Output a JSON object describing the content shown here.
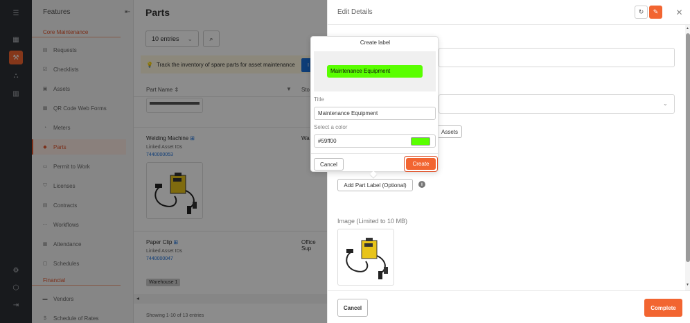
{
  "sidebar": {
    "header": "Features",
    "sections": {
      "core": "Core Maintenance",
      "financial": "Financial"
    },
    "items": [
      {
        "label": "Requests",
        "icon": "requests-icon"
      },
      {
        "label": "Checklists",
        "icon": "checklist-icon"
      },
      {
        "label": "Assets",
        "icon": "assets-icon"
      },
      {
        "label": "QR Code Web Forms",
        "icon": "qr-icon"
      },
      {
        "label": "Meters",
        "icon": "meter-icon"
      },
      {
        "label": "Parts",
        "icon": "parts-icon",
        "active": true
      },
      {
        "label": "Permit to Work",
        "icon": "permit-icon"
      },
      {
        "label": "Licenses",
        "icon": "shield-icon"
      },
      {
        "label": "Contracts",
        "icon": "contract-icon"
      },
      {
        "label": "Workflows",
        "icon": "workflow-icon"
      },
      {
        "label": "Attendance",
        "icon": "attendance-icon"
      },
      {
        "label": "Schedules",
        "icon": "calendar-icon"
      }
    ],
    "financial_items": [
      {
        "label": "Vendors",
        "icon": "vendor-icon"
      },
      {
        "label": "Schedule of Rates",
        "icon": "dollar-icon"
      }
    ]
  },
  "main": {
    "title": "Parts",
    "entries_select": "10 entries",
    "info_text": "Track the inventory of spare parts for asset maintenance",
    "info_button": "I",
    "columns": {
      "part_name": "Part Name",
      "storage": "Sto"
    },
    "rows": [
      {
        "name": "Welding Machine",
        "sub": "Linked Asset IDs",
        "link": "7440000053",
        "storage": "Wa"
      },
      {
        "name": "Paper Clip",
        "sub": "Linked Asset IDs",
        "link": "7440000047",
        "storage": "Office Sup"
      }
    ],
    "warehouse_badge": "Warehouse 1",
    "footer": "Showing 1-10 of 13 entries"
  },
  "panel": {
    "title": "Edit Details",
    "assets_button": "Assets",
    "add_label_button": "Add Part Label (Optional)",
    "info_icon_glyph": "i",
    "image_label": "Image (Limited to 10 MB)",
    "cancel": "Cancel",
    "complete": "Complete"
  },
  "popover": {
    "title": "Create label",
    "preview_text": "Maintenance Equipment",
    "title_label": "Title",
    "title_value": "Maintenance Equipment",
    "color_label": "Select a color",
    "color_value": "#59ff00",
    "cancel": "Cancel",
    "create": "Create"
  },
  "colors": {
    "accent": "#f26531",
    "label_color": "#59ff00",
    "link": "#1a6fd9"
  }
}
